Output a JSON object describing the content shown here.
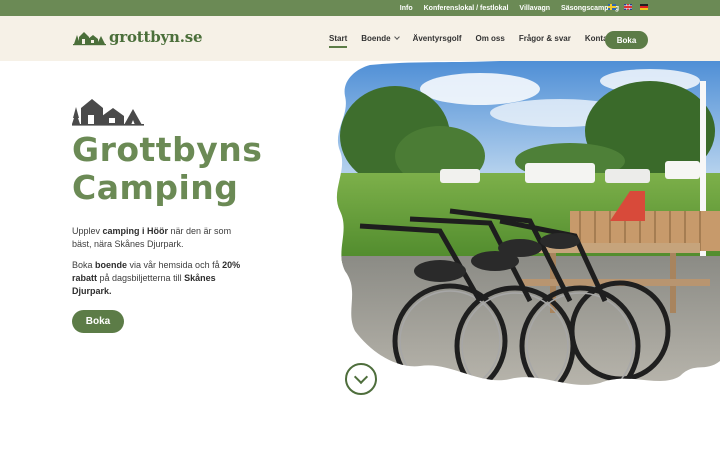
{
  "topbar": {
    "links": [
      "Info",
      "Konferenslokal / festlokal",
      "Villavagn",
      "Säsongscamping"
    ],
    "languages": [
      "sv-flag-icon",
      "en-flag-icon",
      "de-flag-icon"
    ]
  },
  "header": {
    "logo_text": "grottbyn.se",
    "nav": [
      {
        "label": "Start",
        "active": true
      },
      {
        "label": "Boende",
        "dropdown": true
      },
      {
        "label": "Äventyrsgolf"
      },
      {
        "label": "Om oss"
      },
      {
        "label": "Frågor & svar"
      },
      {
        "label": "Kontakt"
      }
    ],
    "book_label": "Boka"
  },
  "hero": {
    "title_line1": "Grottbyns",
    "title_line2": "Camping",
    "p1_a": "Upplev ",
    "p1_b": "camping i Höör",
    "p1_c": " när den är som bäst, nära Skånes Djurpark.",
    "p2_a": "Boka ",
    "p2_b": "boende",
    "p2_c": " via vår hemsida och få ",
    "p2_d": "20% rabatt",
    "p2_e": " på dagsbiljetterna till ",
    "p2_f": "Skånes Djurpark.",
    "book_label": "Boka"
  },
  "colors": {
    "brand_green": "#6b8a55",
    "dark_green": "#5c7c47",
    "header_bg": "#f6f1e7"
  },
  "icons": {
    "scroll": "chevron-down-icon",
    "hero": "village-icon"
  }
}
